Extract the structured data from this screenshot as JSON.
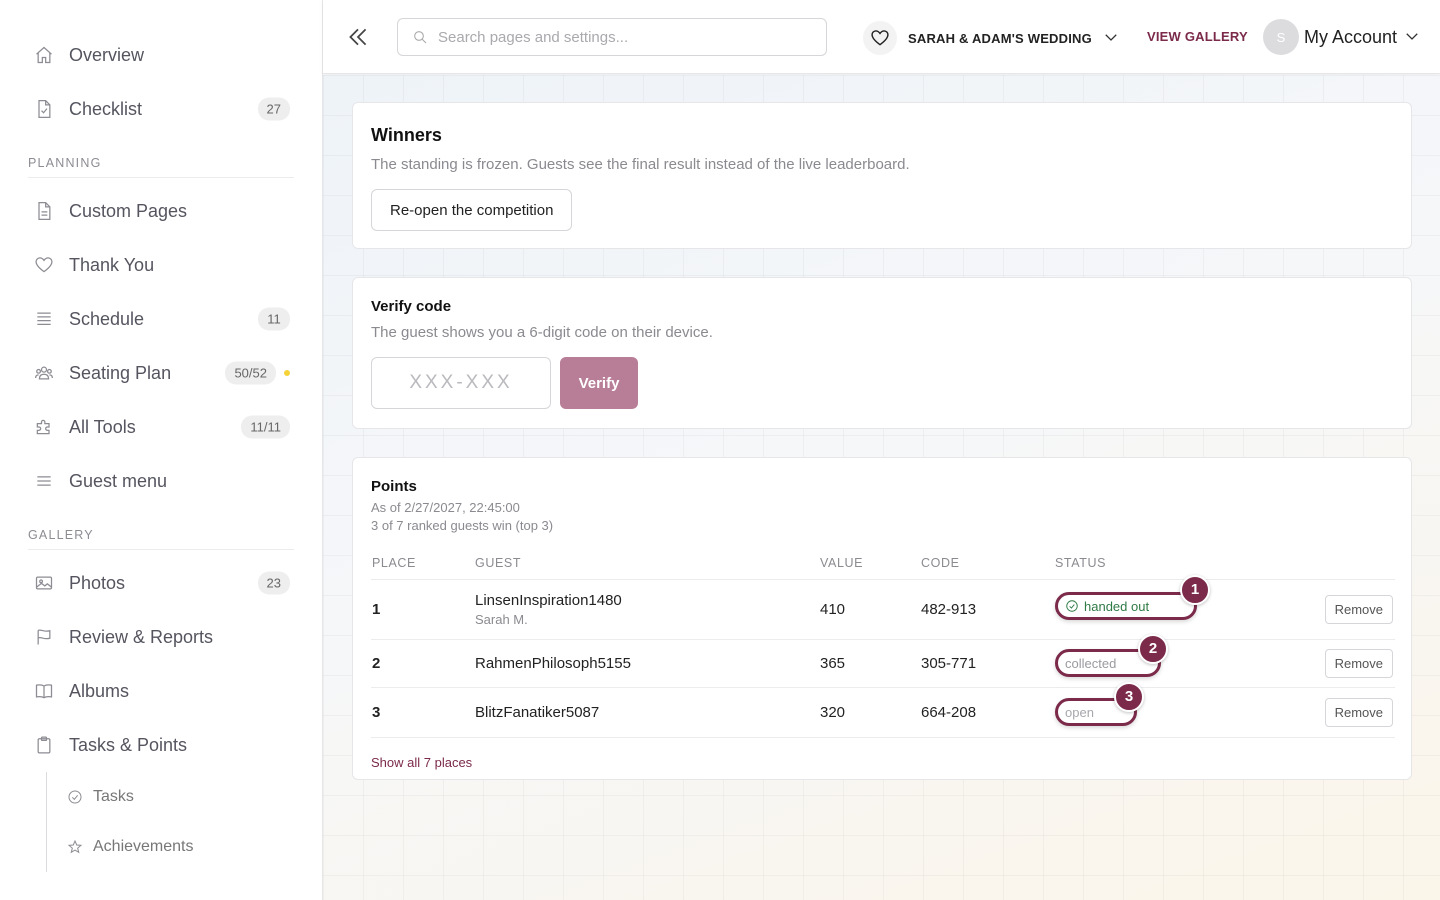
{
  "sidebar": {
    "items": [
      {
        "label": "Overview",
        "icon": "home-icon"
      },
      {
        "label": "Checklist",
        "icon": "checklist-icon",
        "badge": "27"
      }
    ],
    "planning_title": "PLANNING",
    "planning": [
      {
        "label": "Custom Pages",
        "icon": "page-icon"
      },
      {
        "label": "Thank You",
        "icon": "heart-icon"
      },
      {
        "label": "Schedule",
        "icon": "list-icon",
        "badge": "11"
      },
      {
        "label": "Seating Plan",
        "icon": "people-icon",
        "badge": "50/52"
      },
      {
        "label": "All Tools",
        "icon": "puzzle-icon",
        "badge": "11/11"
      },
      {
        "label": "Guest menu",
        "icon": "menu-icon"
      }
    ],
    "gallery_title": "GALLERY",
    "gallery": [
      {
        "label": "Photos",
        "icon": "image-icon",
        "badge": "23"
      },
      {
        "label": "Review & Reports",
        "icon": "flag-icon"
      },
      {
        "label": "Albums",
        "icon": "book-icon"
      },
      {
        "label": "Tasks & Points",
        "icon": "clipboard-icon"
      }
    ],
    "sub": [
      {
        "label": "Tasks",
        "icon": "check-circle-icon"
      },
      {
        "label": "Achievements",
        "icon": "star-icon"
      }
    ],
    "seating_dot_color": "#f5d33a"
  },
  "topbar": {
    "search_placeholder": "Search pages and settings...",
    "wedding": "SARAH & ADAM'S WEDDING",
    "view_gallery": "VIEW GALLERY",
    "avatar_initial": "S",
    "account": "My Account"
  },
  "winners": {
    "title": "Winners",
    "description": "The standing is frozen. Guests see the final result instead of the live leaderboard.",
    "reopen_label": "Re-open the competition"
  },
  "verify": {
    "title": "Verify code",
    "description": "The guest shows you a 6-digit code on their device.",
    "placeholder": "XXX-XXX",
    "button": "Verify"
  },
  "points": {
    "title": "Points",
    "as_of": "As of 2/27/2027, 22:45:00",
    "summary": "3 of 7 ranked guests win (top 3)",
    "headers": [
      "PLACE",
      "GUEST",
      "VALUE",
      "CODE",
      "STATUS"
    ],
    "rows": [
      {
        "place": "1",
        "guest": "LinsenInspiration1480",
        "guest_sub": "Sarah M.",
        "value": "410",
        "code": "482-913",
        "status": "handed out",
        "marker": "1",
        "remove": "Remove"
      },
      {
        "place": "2",
        "guest": "RahmenPhilosoph5155",
        "value": "365",
        "code": "305-771",
        "status": "collected",
        "marker": "2",
        "remove": "Remove"
      },
      {
        "place": "3",
        "guest": "BlitzFanatiker5087",
        "value": "320",
        "code": "664-208",
        "status": "open",
        "marker": "3",
        "remove": "Remove"
      }
    ],
    "show_all": "Show all 7 places"
  },
  "colors": {
    "accent": "#7b2a4a",
    "verify_button": "#b87d97",
    "handed_out_text": "#2e7a45"
  }
}
